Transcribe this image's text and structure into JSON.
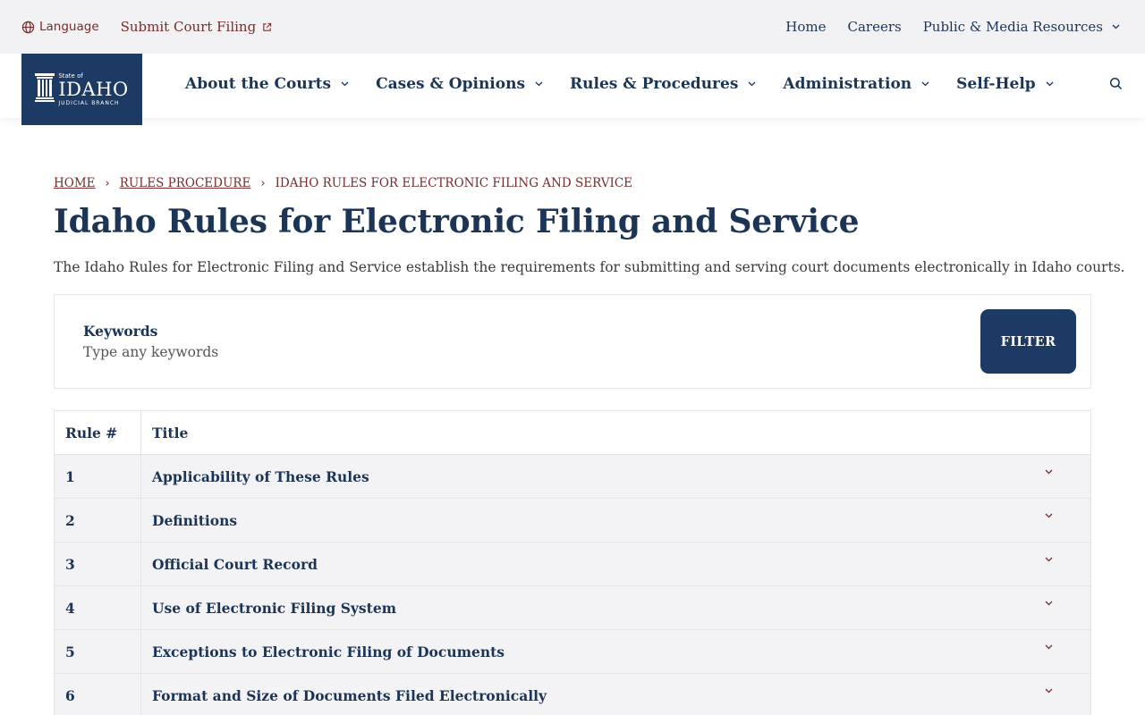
{
  "utility": {
    "language_label": "Language",
    "filing_label": "Submit Court Filing",
    "links": [
      "Home",
      "Careers",
      "Public & Media Resources"
    ]
  },
  "logo": {
    "state": "State of",
    "name": "IDAHO",
    "branch": "JUDICIAL BRANCH"
  },
  "nav": {
    "items": [
      "About the Courts",
      "Cases & Opinions",
      "Rules & Procedures",
      "Administration",
      "Self-Help"
    ]
  },
  "breadcrumb": {
    "home": "HOME",
    "parent": "RULES PROCEDURE",
    "current": "IDAHO RULES FOR ELECTRONIC FILING AND SERVICE"
  },
  "page": {
    "title": "Idaho Rules for Electronic Filing and Service",
    "description": "The Idaho Rules for Electronic Filing and Service establish the requirements for submitting and serving court documents electronically in Idaho courts."
  },
  "filter": {
    "keywords_label": "Keywords",
    "keywords_placeholder": "Type any keywords",
    "button_label": "FILTER"
  },
  "table": {
    "headers": [
      "Rule #",
      "Title"
    ],
    "rows": [
      {
        "num": "1",
        "title": "Applicability of These Rules"
      },
      {
        "num": "2",
        "title": "Definitions"
      },
      {
        "num": "3",
        "title": "Official Court Record"
      },
      {
        "num": "4",
        "title": "Use of Electronic Filing System"
      },
      {
        "num": "5",
        "title": "Exceptions to Electronic Filing of Documents"
      },
      {
        "num": "6",
        "title": "Format and Size of Documents Filed Electronically"
      }
    ]
  },
  "colors": {
    "navy": "#1c3557",
    "logo_bg": "#1c3a64",
    "maroon": "#7a2b2b",
    "utility_bg": "#f2f2f4",
    "row_bg": "#f3f3f5"
  }
}
